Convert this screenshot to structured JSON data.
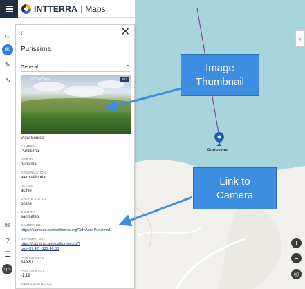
{
  "app": {
    "brand": "INTTERRA",
    "separator": "|",
    "product": "Maps"
  },
  "panel": {
    "back_icon": "‹",
    "close_icon": "✕",
    "title": "Purissima",
    "section": "General",
    "thumbnail": {
      "source_label": "UCSanDiego",
      "badge": "PTZ"
    },
    "view_source": "View Source",
    "fields": [
      {
        "label": "CAMERA",
        "value": "Purissima"
      },
      {
        "label": "SITE ID",
        "value": "purisima"
      },
      {
        "label": "ORGANIZATION",
        "value": "alertcalifornia"
      },
      {
        "label": "ACTIVE",
        "value": "active"
      },
      {
        "label": "ONLINE STATUS",
        "value": "online"
      },
      {
        "label": "COUNTY",
        "value": "sanmateo"
      }
    ],
    "camera_url": {
      "label": "CAMERA URL",
      "value": "https://cameras.alertcalifornia.org/?id=Axis-Purisima1"
    },
    "network_url": {
      "label": "NETWORK URL",
      "line1": "https://cameras.alertcalifornia.org/?",
      "line2": "pos=37.42_-122.40.30"
    },
    "position_pan": {
      "label": "POSITION PAN",
      "value": "349.51"
    },
    "position_tilt": {
      "label": "POSITION TILT",
      "value": "-1.19"
    },
    "view_zoom_scale": {
      "label": "VIEW ZOOM SCALE"
    }
  },
  "map": {
    "marker_label": "Purissima",
    "zoom_in": "+",
    "zoom_out": "−",
    "locate_icon": "◎",
    "collapse_icon": "‹"
  },
  "callouts": {
    "image": {
      "line1": "Image",
      "line2": "Thumbnail"
    },
    "link": {
      "line1": "Link to",
      "line2": "Camera"
    }
  },
  "rail": {
    "icons": [
      "chat-icon",
      "mail-icon",
      "pencil-icon",
      "chart-icon",
      "message-icon",
      "help-icon",
      "list-icon"
    ],
    "ops_label": "ops"
  },
  "colors": {
    "callout": "#3d8de0",
    "water": "#a8d4dc",
    "land": "#f1f0ec",
    "marker": "#1c5fb5",
    "nav": "#1f2d3d"
  }
}
